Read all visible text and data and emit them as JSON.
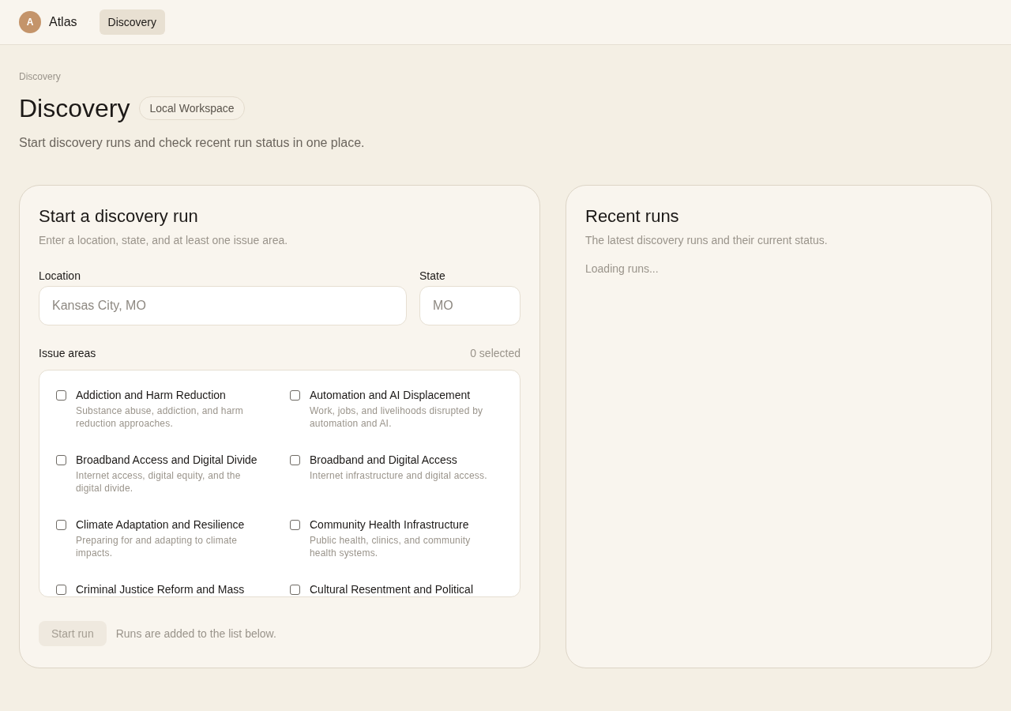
{
  "header": {
    "logo_letter": "A",
    "app_name": "Atlas",
    "nav": [
      {
        "label": "Discovery",
        "selected": true
      }
    ]
  },
  "breadcrumb": "Discovery",
  "page": {
    "title": "Discovery",
    "badge": "Local Workspace",
    "subtitle": "Start discovery runs and check recent run status in one place."
  },
  "start_card": {
    "title": "Start a discovery run",
    "subtitle": "Enter a location, state, and at least one issue area.",
    "location": {
      "label": "Location",
      "placeholder": "Kansas City, MO"
    },
    "state": {
      "label": "State",
      "placeholder": "MO"
    },
    "issue_areas": {
      "label": "Issue areas",
      "count": "0 selected",
      "items": [
        {
          "title": "Addiction and Harm Reduction",
          "description": "Substance abuse, addiction, and harm reduction approaches.",
          "checked": false
        },
        {
          "title": "Automation and AI Displacement",
          "description": "Work, jobs, and livelihoods disrupted by automation and AI.",
          "checked": false
        },
        {
          "title": "Broadband Access and Digital Divide",
          "description": "Internet access, digital equity, and the digital divide.",
          "checked": false
        },
        {
          "title": "Broadband and Digital Access",
          "description": "Internet infrastructure and digital access.",
          "checked": false
        },
        {
          "title": "Climate Adaptation and Resilience",
          "description": "Preparing for and adapting to climate impacts.",
          "checked": false
        },
        {
          "title": "Community Health Infrastructure",
          "description": "Public health, clinics, and community health systems.",
          "checked": false
        },
        {
          "title": "Criminal Justice Reform and Mass",
          "checked": false
        },
        {
          "title": "Cultural Resentment and Political",
          "checked": false
        }
      ]
    },
    "submit": {
      "label": "Start run",
      "disabled": true
    },
    "note": "Runs are added to the list below."
  },
  "recent_card": {
    "title": "Recent runs",
    "subtitle": "The latest discovery runs and their current status.",
    "status": "Loading runs..."
  }
}
